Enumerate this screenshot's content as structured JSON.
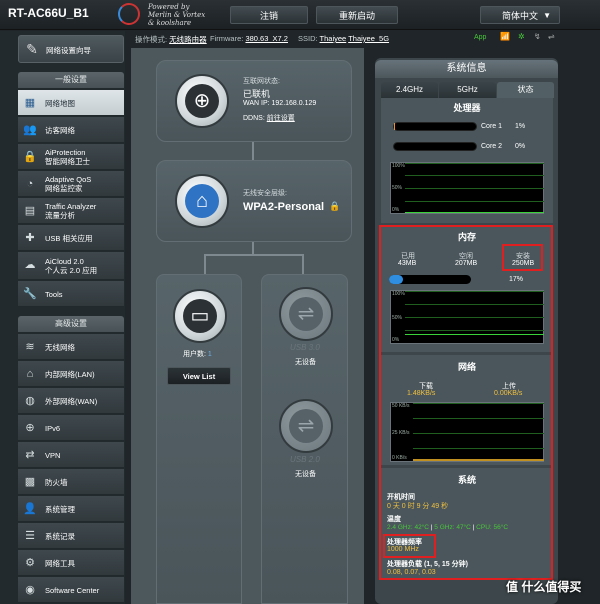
{
  "header": {
    "model": "RT-AC66U_B1",
    "logo_line1": "Powered by",
    "logo_line2": "Merlin & Vortex",
    "logo_line3": "& koolshare",
    "logout": "注销",
    "reboot": "重新启动",
    "language": "简体中文"
  },
  "status_bar": {
    "mode_label": "操作模式:",
    "mode_value": "无线路由器",
    "firmware_label": "Firmware:",
    "firmware_value": "380.63_X7.2",
    "ssid_label": "SSID:",
    "ssid_1": "Thaiyee",
    "ssid_2": "Thaiyee_5G",
    "app": "App"
  },
  "sidebar": {
    "wizard": "网络设置向导",
    "general_title": "一般设置",
    "general_items": [
      {
        "label": "网络地图",
        "label2": ""
      },
      {
        "label": "访客网络",
        "label2": ""
      },
      {
        "label": "AiProtection",
        "label2": "智能网络卫士"
      },
      {
        "label": "Adaptive QoS",
        "label2": "网络监控家"
      },
      {
        "label": "Traffic Analyzer",
        "label2": "流量分析"
      },
      {
        "label": "USB 相关应用",
        "label2": ""
      },
      {
        "label": "AiCloud 2.0",
        "label2": "个人云 2.0 应用"
      },
      {
        "label": "Tools",
        "label2": ""
      }
    ],
    "advanced_title": "高级设置",
    "advanced_items": [
      "无线网络",
      "内部网络(LAN)",
      "外部网络(WAN)",
      "IPv6",
      "VPN",
      "防火墙",
      "系统管理",
      "系统记录",
      "网络工具",
      "Software Center"
    ]
  },
  "map": {
    "internet_label": "互联网状态:",
    "internet_status": "已联机",
    "wan_ip": "WAN IP: 192.168.0.129",
    "ddns_label": "DDNS:",
    "ddns_link": "前往设置",
    "security_label": "无线安全层级:",
    "security_value": "WPA2-Personal",
    "clients_label": "用户数:",
    "clients_value": "1",
    "view_list": "View List",
    "usb1": "USB 3.0",
    "usb1_status": "无设备",
    "usb2": "USB 2.0",
    "usb2_status": "无设备"
  },
  "system_panel": {
    "title": "系统信息",
    "tabs": [
      "2.4GHz",
      "5GHz",
      "状态"
    ],
    "cpu": {
      "title": "处理器",
      "core1_label": "Core 1",
      "core1_value": "1%",
      "core2_label": "Core 2",
      "core2_value": "0%",
      "y_labels": [
        "100%",
        "50%",
        "0%"
      ]
    },
    "memory": {
      "title": "内存",
      "used_label": "已用",
      "used_value": "43MB",
      "free_label": "空闲",
      "free_value": "207MB",
      "total_label": "安装",
      "total_value": "250MB",
      "percent": "17%",
      "bar_fill": 0.17,
      "y_labels": [
        "100%",
        "50%",
        "0%"
      ]
    },
    "network": {
      "title": "网络",
      "down_label": "下载",
      "down_value": "1.48KB/s",
      "up_label": "上传",
      "up_value": "0.00KB/s",
      "y_labels": [
        "50 KB/s",
        "25 KB/s",
        "0 KB/s"
      ]
    },
    "system": {
      "title": "系统",
      "uptime_label": "开机时间",
      "uptime_value": "0 天 0 时 9 分 49 秒",
      "temp_label": "温度",
      "temp_24": "2.4 GHz: 42°C",
      "temp_5": "5 GHz: 47°C",
      "temp_cpu": "CPU: 56°C",
      "freq_label": "处理器频率",
      "freq_value": "1000 MHz",
      "load_label": "处理器负载 (1, 5, 15 分钟)",
      "load_value": "0.08, 0.07, 0.03"
    }
  },
  "watermark": "值 什么值得买",
  "colors": {
    "accent": "#2f73c4",
    "highlight": "#e02020",
    "value": "#f0c040",
    "graph_line": "#3ad43a"
  }
}
